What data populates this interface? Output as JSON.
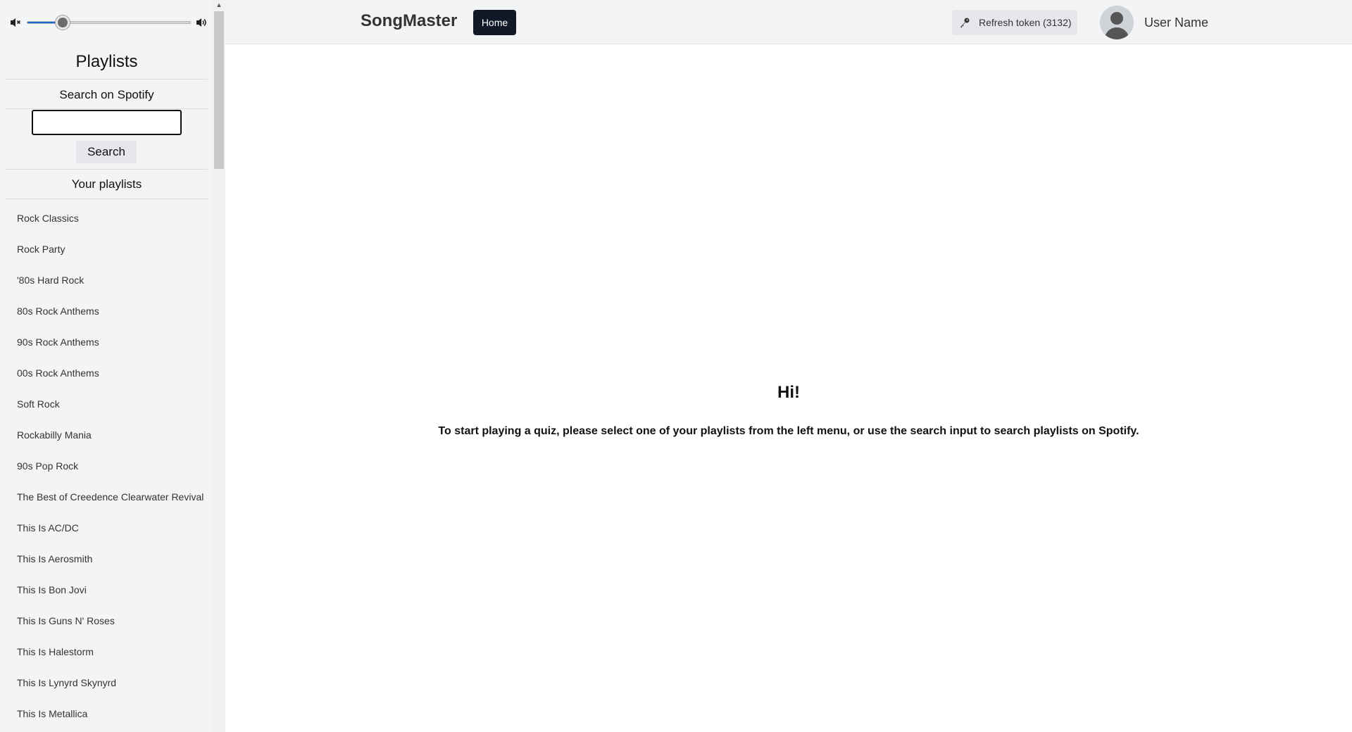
{
  "sidebar": {
    "playlists_title": "Playlists",
    "search_label": "Search on Spotify",
    "search_value": "",
    "search_button": "Search",
    "your_playlists_label": "Your playlists",
    "volume_level": 0.22,
    "playlists": [
      "Rock Classics",
      "Rock Party",
      "'80s Hard Rock",
      "80s Rock Anthems",
      "90s Rock Anthems",
      "00s Rock Anthems",
      "Soft Rock",
      "Rockabilly Mania",
      "90s Pop Rock",
      "The Best of Creedence Clearwater Revival",
      "This Is AC/DC",
      "This Is Aerosmith",
      "This Is Bon Jovi",
      "This Is Guns N' Roses",
      "This Is Halestorm",
      "This Is Lynyrd Skynyrd",
      "This Is Metallica"
    ]
  },
  "header": {
    "brand": "SongMaster",
    "home_label": "Home",
    "refresh_label": "Refresh token (3132)",
    "user_name": "User Name"
  },
  "main": {
    "greeting": "Hi!",
    "instructions": "To start playing a quiz, please select one of your playlists from the left menu, or use the search input to search playlists on Spotify."
  },
  "colors": {
    "accent": "#1a66d2",
    "home_button_bg": "#111827",
    "sidebar_bg": "#f3f4f6"
  },
  "icons": [
    "volume-mute-icon",
    "volume-up-icon",
    "key-icon",
    "user-avatar-icon",
    "scroll-up-arrow-icon"
  ]
}
